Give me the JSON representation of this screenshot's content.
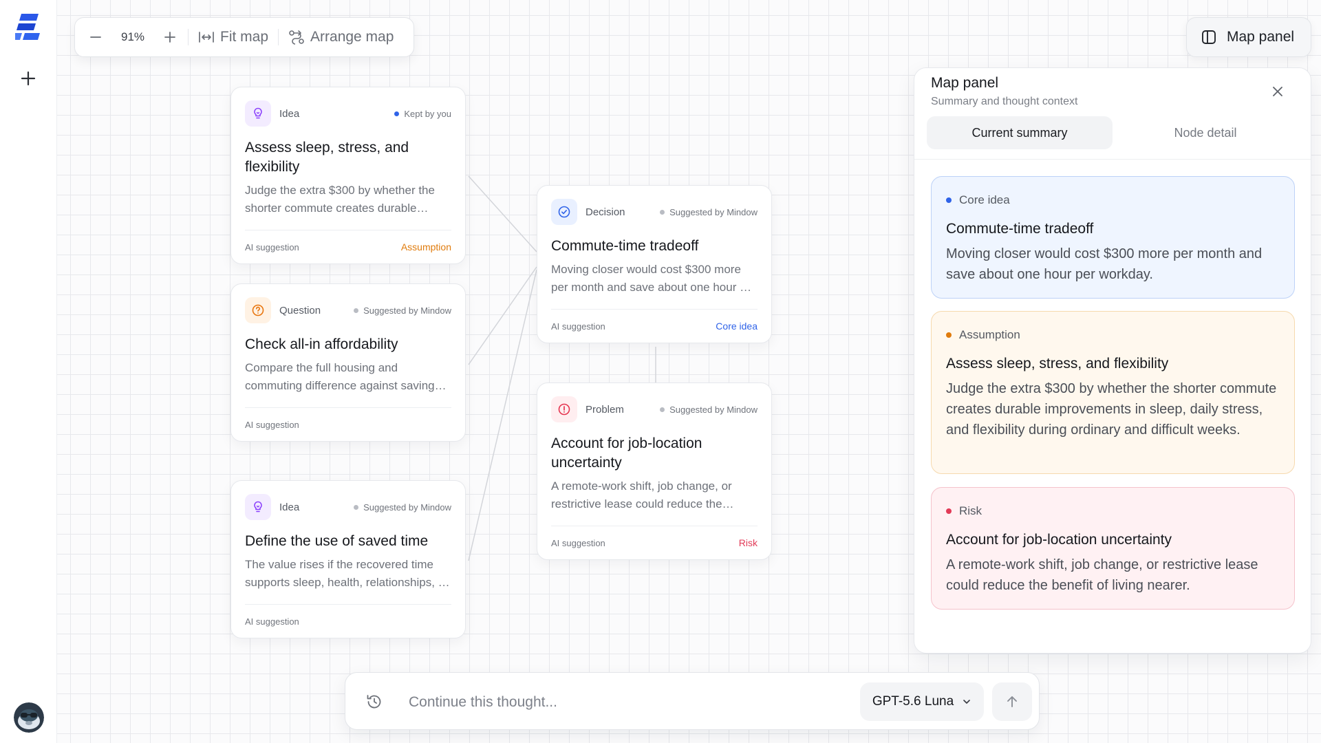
{
  "toolbar": {
    "zoom_level": "91%",
    "fit_map_label": "Fit map",
    "arrange_map_label": "Arrange map"
  },
  "panel_toggle": {
    "label": "Map panel"
  },
  "nodes": [
    {
      "type": "Idea",
      "origin": "Kept by you",
      "title": "Assess sleep, stress, and flexibility",
      "description": "Judge the extra $300 by whether the shorter commute creates durable improvements in sleep, daily stress, and flexibility during ordinary and difficult weeks.",
      "ai_label": "AI suggestion",
      "tag": "Assumption"
    },
    {
      "type": "Question",
      "origin": "Suggested by Mindow",
      "title": "Check all-in affordability",
      "description": "Compare the full housing and commuting difference against savings goals and monthly budget.",
      "ai_label": "AI suggestion",
      "tag": ""
    },
    {
      "type": "Idea",
      "origin": "Suggested by Mindow",
      "title": "Define the use of saved time",
      "description": "The value rises if the recovered time supports sleep, health, relationships, or focused work.",
      "ai_label": "AI suggestion",
      "tag": ""
    },
    {
      "type": "Decision",
      "origin": "Suggested by Mindow",
      "title": "Commute-time tradeoff",
      "description": "Moving closer would cost $300 more per month and save about one hour per workday.",
      "ai_label": "AI suggestion",
      "tag": "Core idea"
    },
    {
      "type": "Problem",
      "origin": "Suggested by Mindow",
      "title": "Account for job-location uncertainty",
      "description": "A remote-work shift, job change, or restrictive lease could reduce the benefit of living nearer.",
      "ai_label": "AI suggestion",
      "tag": "Risk"
    }
  ],
  "side_panel": {
    "title": "Map panel",
    "subtitle": "Summary and thought context",
    "tabs": [
      {
        "label": "Current summary",
        "active": true
      },
      {
        "label": "Node detail",
        "active": false
      }
    ],
    "cards": [
      {
        "label": "Core idea",
        "title": "Commute-time tradeoff",
        "body": "Moving closer would cost $300 more per month and save about one hour per workday."
      },
      {
        "label": "Assumption",
        "title": "Assess sleep, stress, and flexibility",
        "body": "Judge the extra $300 by whether the shorter commute creates durable improvements in sleep, daily stress, and flexibility during ordinary and difficult weeks."
      },
      {
        "label": "Risk",
        "title": "Account for job-location uncertainty",
        "body": "A remote-work shift, job change, or restrictive lease could reduce the benefit of living nearer."
      }
    ]
  },
  "composer": {
    "placeholder": "Continue this thought...",
    "model": "GPT-5.6 Luna"
  },
  "icons": {
    "logo": "brand-logo-icon",
    "new": "plus-icon",
    "zoom_out": "minus-icon",
    "zoom_in": "plus-icon",
    "fit": "fit-width-icon",
    "arrange": "arrange-nodes-icon",
    "panel": "sidebar-panel-icon",
    "close": "close-icon",
    "history": "history-icon",
    "chevron": "chevron-down-icon",
    "send": "arrow-up-icon",
    "idea": "lightbulb-icon",
    "question": "question-circle-icon",
    "decision": "check-circle-icon",
    "problem": "alert-circle-icon"
  },
  "colors": {
    "brand": "#2454e6",
    "idea_purple": "#8a3ffc",
    "question_orange": "#e8750e",
    "decision_blue": "#2f63e8",
    "problem_red": "#e5344f",
    "assumption_tag": "#e07b0c",
    "core_tag": "#2f63e8",
    "risk_tag": "#e23a57",
    "kept_dot": "#2f63e8",
    "suggested_dot": "#b9bcc3"
  }
}
